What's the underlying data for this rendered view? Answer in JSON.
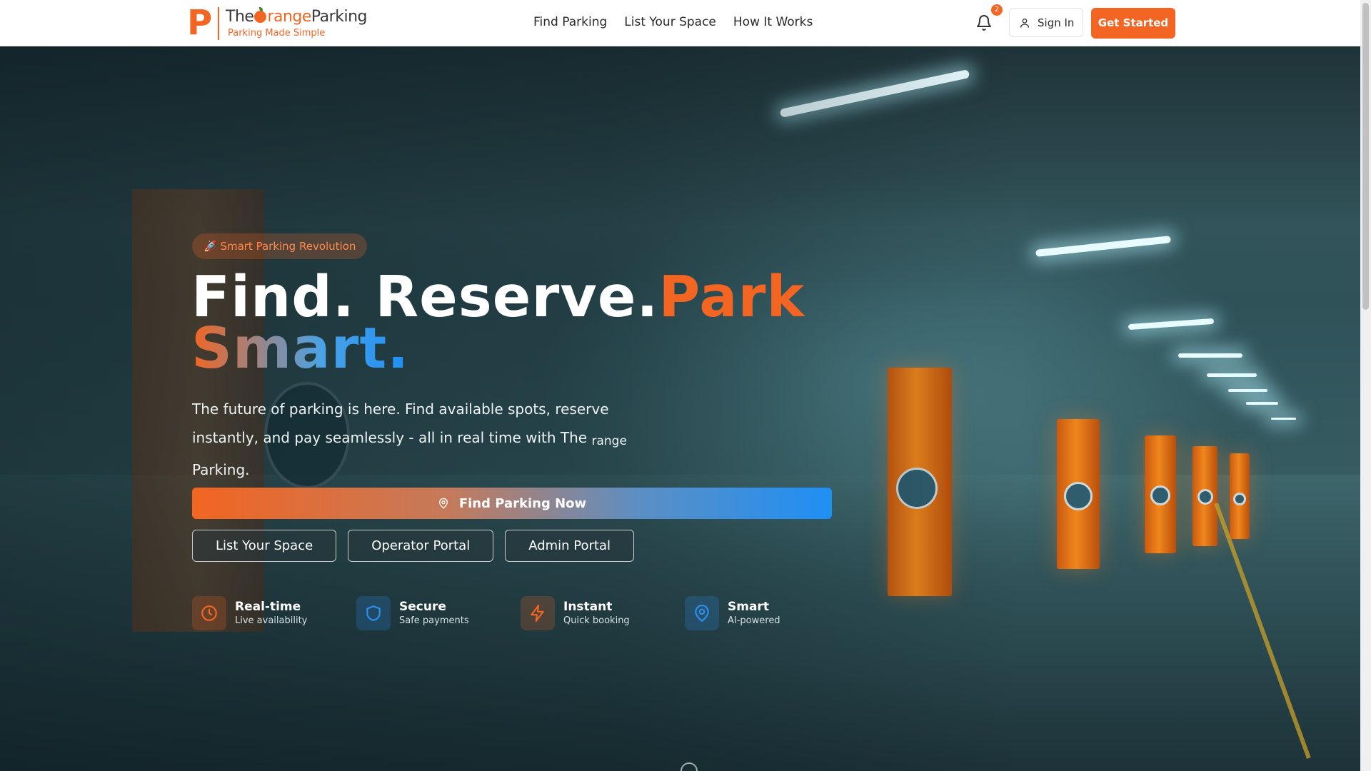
{
  "brand": {
    "logo_letter": "P",
    "name_prefix": "The",
    "name_orange": "range",
    "name_suffix": "Parking",
    "tagline": "Parking Made Simple",
    "accent_color": "#f26522"
  },
  "nav": {
    "links": [
      "Find Parking",
      "List Your Space",
      "How It Works"
    ],
    "notification_count": "2",
    "sign_in_label": "Sign In",
    "get_started_label": "Get Started"
  },
  "hero": {
    "badge": "🚀 Smart Parking Revolution",
    "headline_white": "Find. Reserve.",
    "headline_orange": "Park",
    "headline_gradient": "Smart.",
    "subtitle": "The future of parking is here. Find available spots, reserve instantly, and pay seamlessly - all in real time with The",
    "subtitle_broken_image_alt": "range",
    "subtitle_tail": "Parking.",
    "primary_cta": "Find Parking Now",
    "secondary_ctas": [
      "List Your Space",
      "Operator Portal",
      "Admin Portal"
    ],
    "features": [
      {
        "title": "Real-time",
        "subtitle": "Live availability",
        "icon": "clock-icon",
        "color": "#f26522"
      },
      {
        "title": "Secure",
        "subtitle": "Safe payments",
        "icon": "shield-icon",
        "color": "#2f8ff0"
      },
      {
        "title": "Instant",
        "subtitle": "Quick booking",
        "icon": "lightning-icon",
        "color": "#f26522"
      },
      {
        "title": "Smart",
        "subtitle": "AI-powered",
        "icon": "map-pin-icon",
        "color": "#2f8ff0"
      }
    ]
  }
}
